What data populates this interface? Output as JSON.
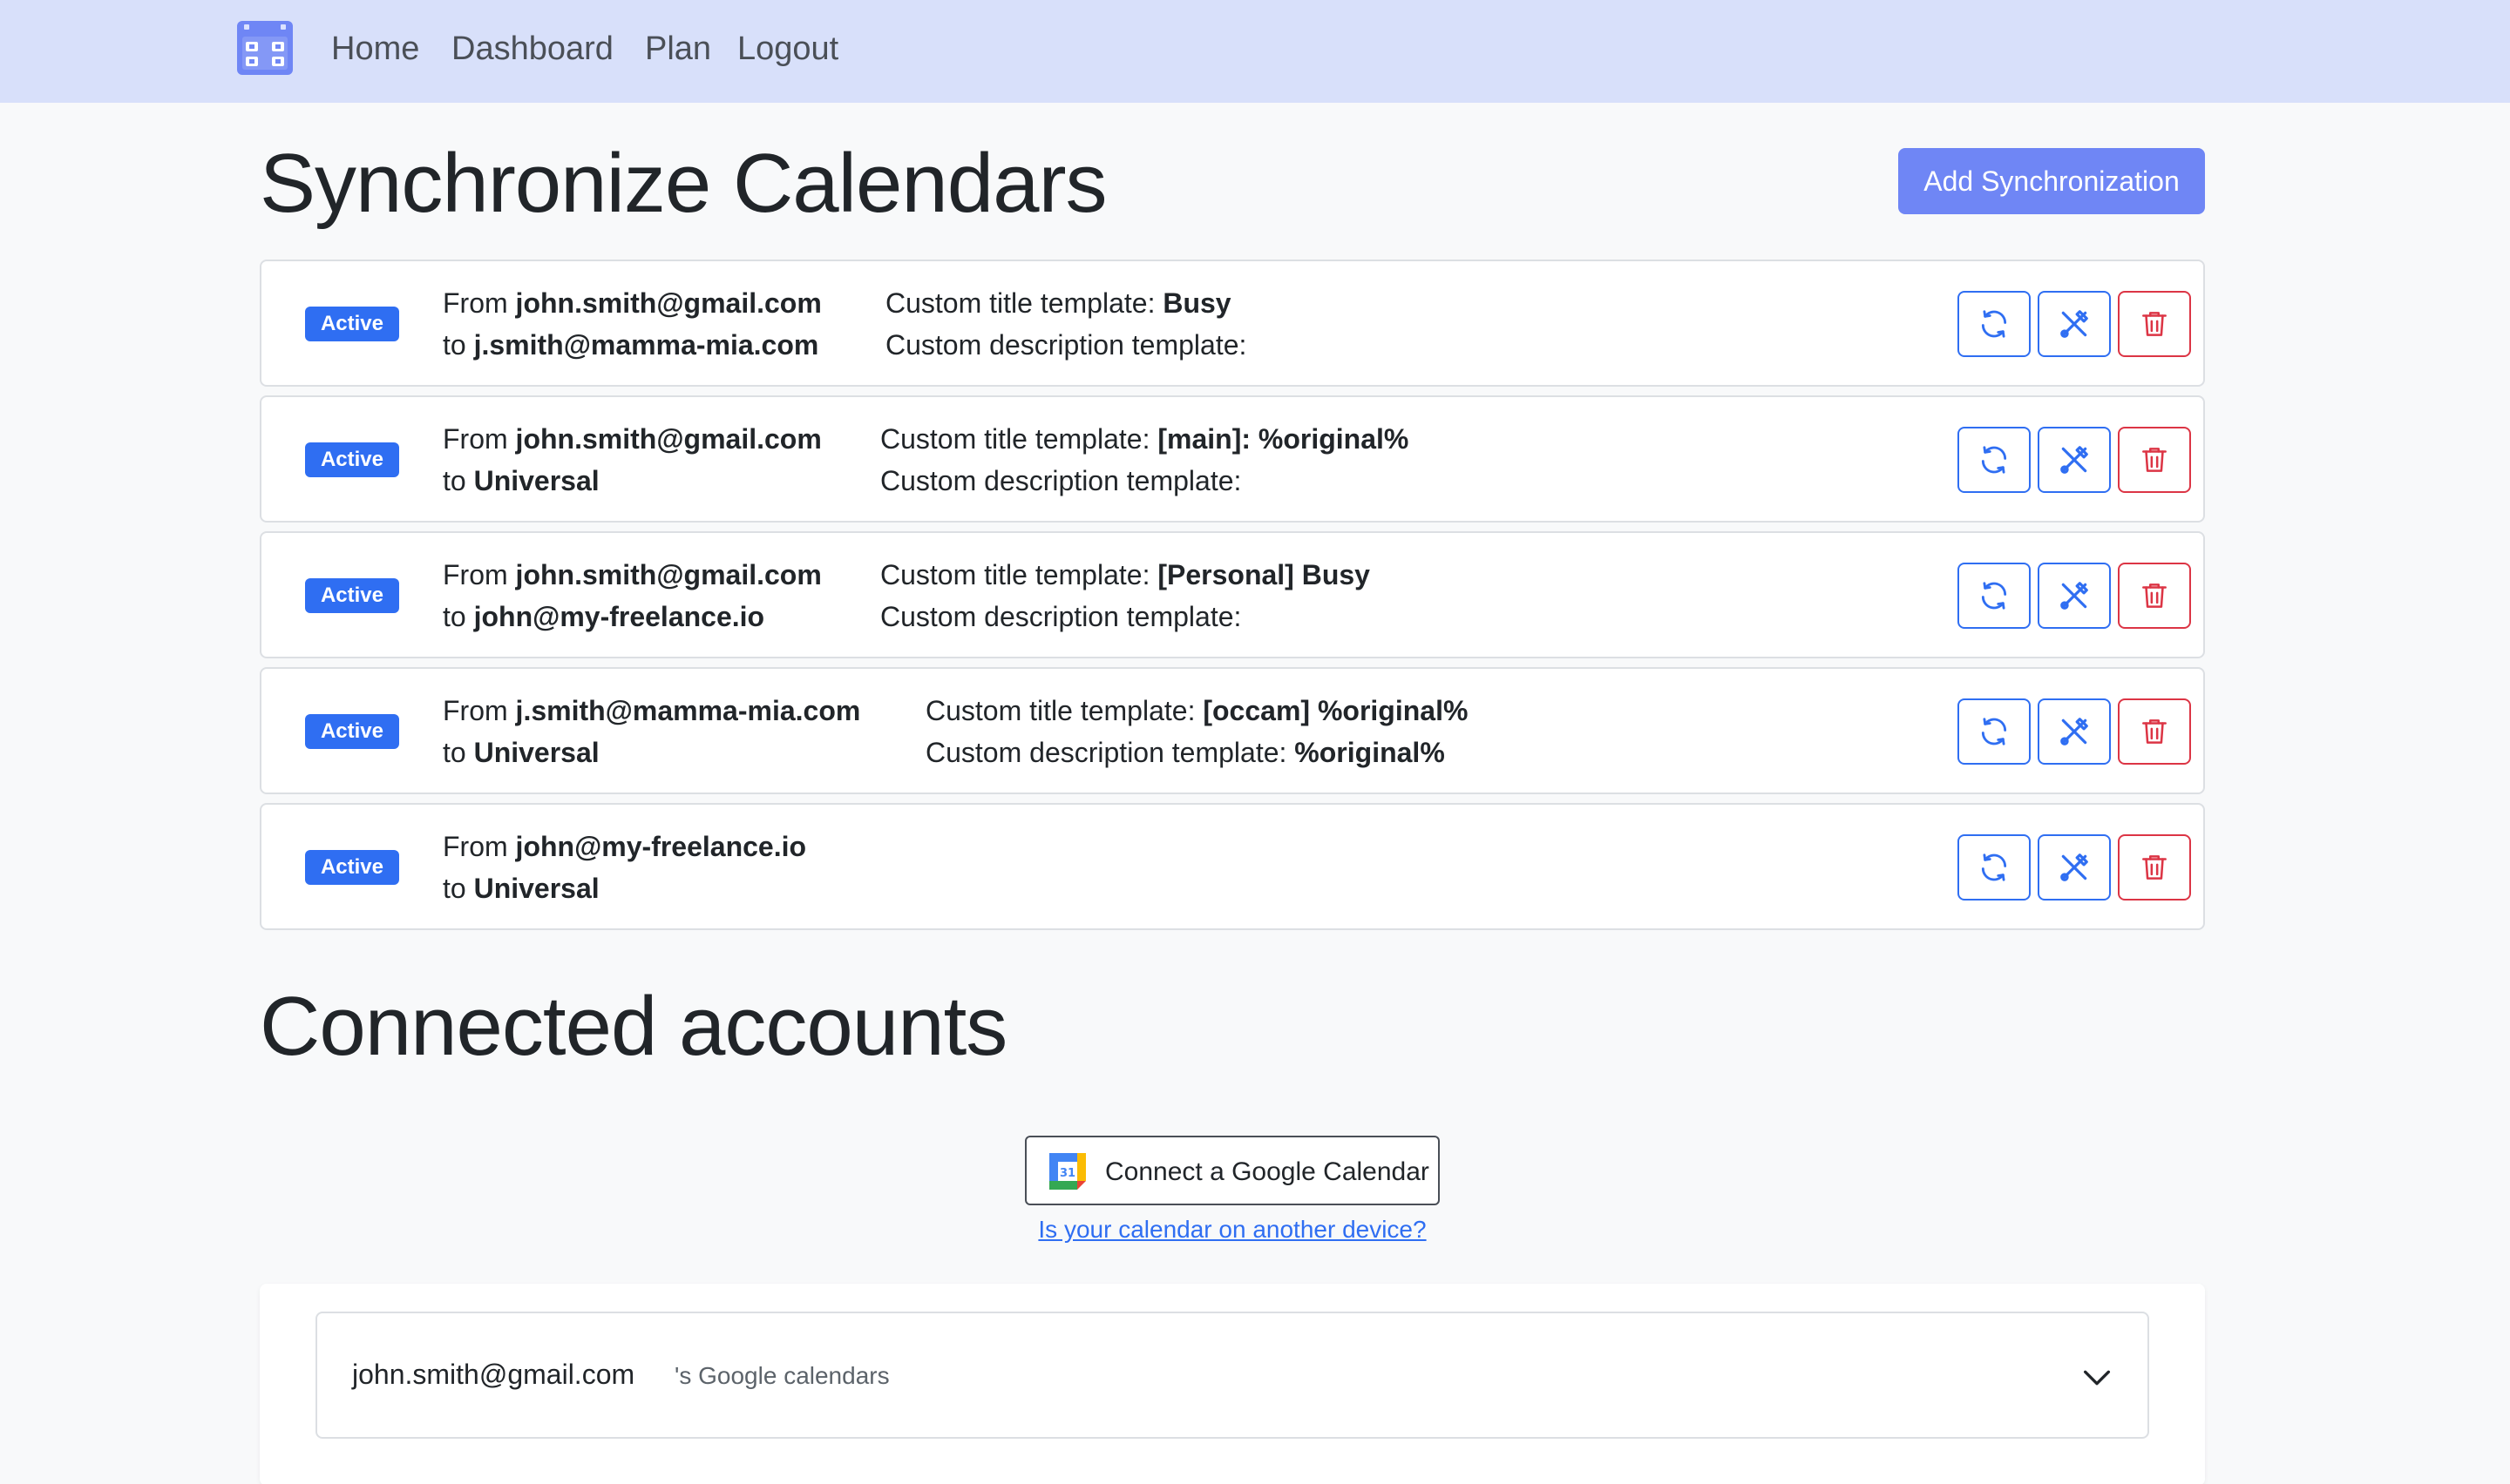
{
  "nav": {
    "links": [
      "Home",
      "Dashboard",
      "Plan",
      "Logout"
    ]
  },
  "sync_section": {
    "title": "Synchronize Calendars",
    "add_button": "Add Synchronization"
  },
  "labels": {
    "from": "From",
    "to": "to",
    "title_template": "Custom title template:",
    "description_template": "Custom description template:"
  },
  "syncs": [
    {
      "status": "Active",
      "from": "john.smith@gmail.com",
      "to": "j.smith@mamma-mia.com",
      "title_template": "Busy",
      "description_template": ""
    },
    {
      "status": "Active",
      "from": "john.smith@gmail.com",
      "to": "Universal",
      "title_template": "[main]: %original%",
      "description_template": ""
    },
    {
      "status": "Active",
      "from": "john.smith@gmail.com",
      "to": "john@my-freelance.io",
      "title_template": "[Personal] Busy",
      "description_template": ""
    },
    {
      "status": "Active",
      "from": "j.smith@mamma-mia.com",
      "to": "Universal",
      "title_template": "[occam] %original%",
      "description_template": "%original%"
    },
    {
      "status": "Active",
      "from": "john@my-freelance.io",
      "to": "Universal"
    }
  ],
  "accounts_section": {
    "title": "Connected accounts",
    "connect_button": "Connect a Google Calendar",
    "device_link": "Is your calendar on another device?",
    "accounts": [
      {
        "email": "john.smith@gmail.com",
        "suffix": "'s Google calendars"
      }
    ]
  },
  "icons": {
    "logo": "calendar-grid-icon",
    "sync": "refresh-icon",
    "edit": "tools-icon",
    "delete": "trash-icon",
    "google": "google-calendar-icon",
    "expand": "chevron-down-icon"
  },
  "colors": {
    "navbar": "#d8e0fa",
    "primary": "#2f6ef2",
    "add_button": "#6f86f5",
    "danger": "#dc3545"
  }
}
